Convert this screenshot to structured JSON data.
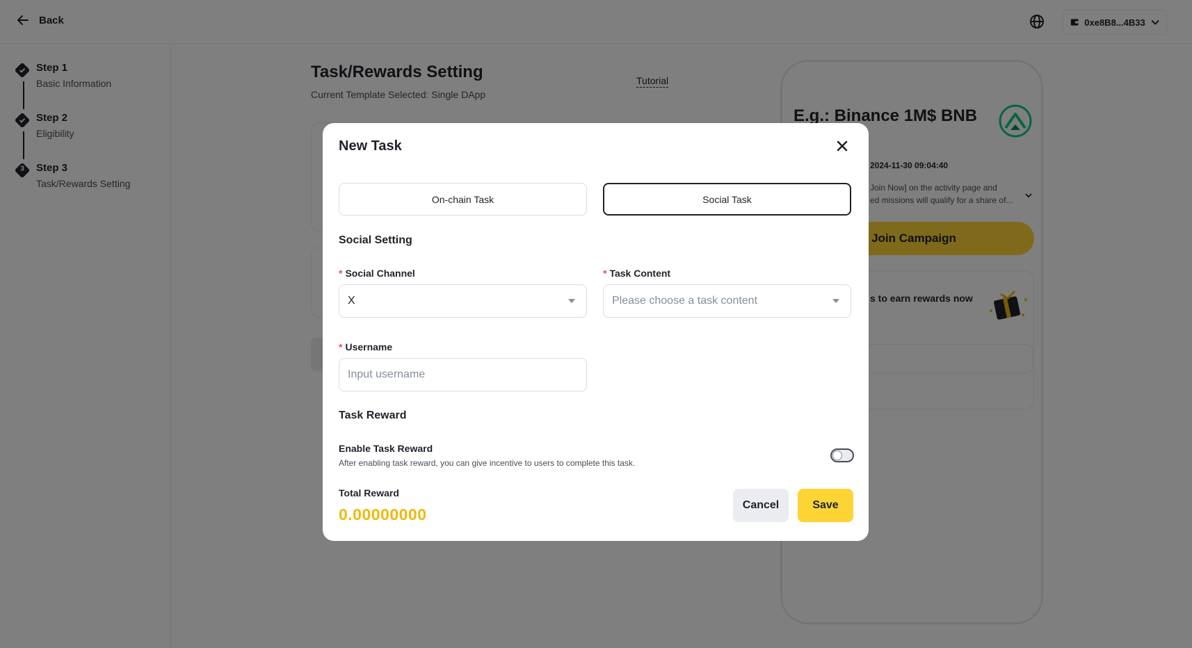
{
  "topbar": {
    "back_label": "Back",
    "wallet_address": "0xe8B8...4B33",
    "language_icon": "globe-icon",
    "wallet_icon": "wallet-icon"
  },
  "sidebar": {
    "steps": [
      {
        "title": "Step 1",
        "subtitle": "Basic Information",
        "state": "done"
      },
      {
        "title": "Step 2",
        "subtitle": "Eligibility",
        "state": "done"
      },
      {
        "title": "Step 3",
        "subtitle": "Task/Rewards Setting",
        "state": "current",
        "badge": "3"
      }
    ]
  },
  "main": {
    "title": "Task/Rewards Setting",
    "subtitle": "Current Template Selected: Single DApp",
    "tutorial_label": "Tutorial"
  },
  "preview": {
    "title": "E.g.: Binance 1M$ BNB",
    "date": "2024-11-30 09:04:40",
    "desc_line1": "Join Now] on the activity page and",
    "desc_line2": "ed missions will qualify for a share of...",
    "join_label": "Join Campaign",
    "earn_text": "s to earn rewards now"
  },
  "modal": {
    "title": "New Task",
    "tabs": [
      {
        "label": "On-chain Task",
        "selected": false
      },
      {
        "label": "Social Task",
        "selected": true
      }
    ],
    "social_setting_title": "Social Setting",
    "social_channel": {
      "label": "Social Channel",
      "value": "X"
    },
    "task_content": {
      "label": "Task Content",
      "placeholder": "Please choose a task content"
    },
    "username": {
      "label": "Username",
      "placeholder": "Input username"
    },
    "required_mark": "*",
    "task_reward_title": "Task Reward",
    "enable_reward": {
      "title": "Enable Task Reward",
      "description": "After enabling task reward, you can give incentive to users to complete this task.",
      "enabled": false
    },
    "total_reward": {
      "label": "Total Reward",
      "value": "0.00000000"
    },
    "cancel_label": "Cancel",
    "save_label": "Save"
  },
  "colors": {
    "accent_yellow": "#fcd535",
    "reward_gold": "#f0b90b",
    "required_red": "#f6465d",
    "text_primary": "#1e2329",
    "overlay": "rgba(0,0,0,0.5)"
  }
}
